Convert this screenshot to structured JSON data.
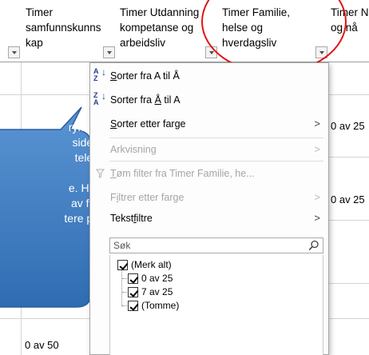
{
  "columns": [
    {
      "header": "Timer\nsamfunnskunns\nkap"
    },
    {
      "header": "Timer Utdanning\nkompetanse og\narbeidsliv"
    },
    {
      "header": "Timer Familie,\nhelse og\nhverdagsliv"
    },
    {
      "header": "Timer N\nog nå"
    }
  ],
  "cells": {
    "row_a_col4": "0 av 25",
    "row_b_col4": "0 av 25",
    "bottom_col1": "0 av 50"
  },
  "menu": {
    "sort_az": {
      "prefix": "",
      "u": "S",
      "rest": "orter fra A til Å"
    },
    "sort_za": {
      "label_a": "Sorter fra ",
      "u": "Å",
      "label_b": " til A"
    },
    "sort_color": {
      "u": "S",
      "rest": "orter etter farge"
    },
    "sheet_view": {
      "label": "Arkvisning"
    },
    "clear_filter": {
      "u": "T",
      "rest": "øm filter fra Timer Familie, he..."
    },
    "filter_color": {
      "a": "F",
      "u": "i",
      "rest": "ltrer etter farge"
    },
    "text_filters": {
      "a": "Tekst",
      "u": "f",
      "rest": "iltre"
    },
    "search_placeholder": "Søk",
    "values": [
      "(Merk alt)",
      "0 av 25",
      "7 av 25",
      "(Tomme)"
    ]
  },
  "callout": {
    "text": "rykker\nsiden\ntelen\n\ne. Her\nav for\ntere på",
    "fill": "#3f7fc4"
  },
  "annotation_color": "#e01414"
}
